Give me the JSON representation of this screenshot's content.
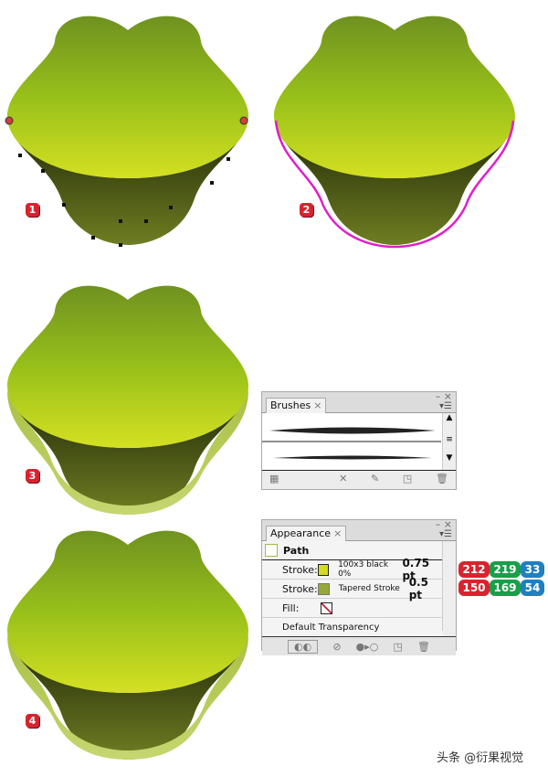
{
  "labels": {
    "step1": "1",
    "step2": "2",
    "step3": "3",
    "step4": "4"
  },
  "brushes": {
    "tab": "Brushes",
    "close": "×"
  },
  "appearance": {
    "tab": "Appearance",
    "close": "×",
    "object": "Path",
    "rows": [
      {
        "label": "Stroke:",
        "swatch": "#d4db21",
        "name": "100x3 black 0%",
        "weight": "0.75 pt"
      },
      {
        "label": "Stroke:",
        "swatch": "#96a936",
        "name": "Tapered Stroke",
        "weight": "0.5 pt"
      }
    ],
    "fill_label": "Fill:",
    "transparency": "Default Transparency"
  },
  "color_values": {
    "row1": [
      "212",
      "219",
      "33"
    ],
    "row2": [
      "150",
      "169",
      "54"
    ],
    "colors": [
      "#d8232f",
      "#1a9e4a",
      "#1f7fc0"
    ]
  },
  "colors": {
    "head_top": "#6f9120",
    "head_mid": "#98c01a",
    "head_bottom": "#d4e022",
    "jaw": "#3d4a10",
    "outline_magenta": "#e020c8",
    "rim": "#b9cc5a"
  },
  "watermark": "头条 @衍果视觉"
}
